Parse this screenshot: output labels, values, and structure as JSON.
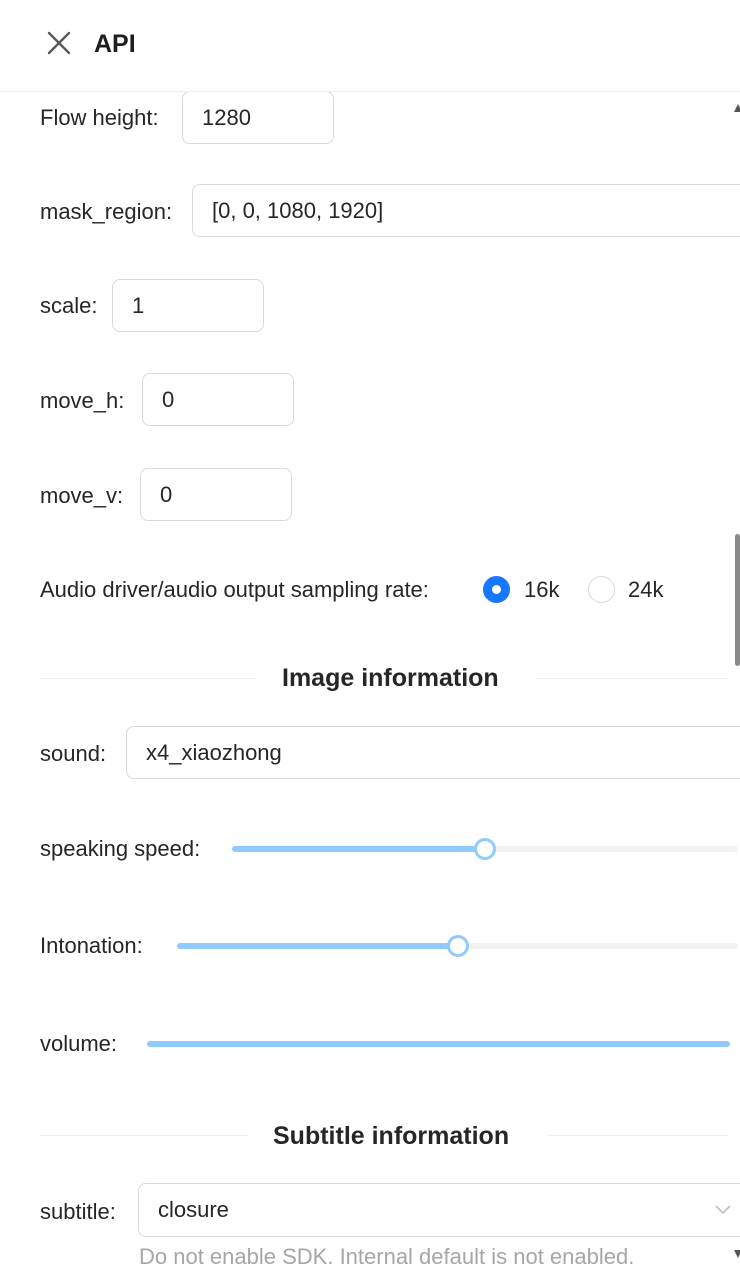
{
  "header": {
    "title": "API"
  },
  "form": {
    "flow_height": {
      "label": "Flow height:",
      "value": "1280"
    },
    "mask_region": {
      "label": "mask_region:",
      "value": "[0, 0, 1080, 1920]"
    },
    "scale": {
      "label": "scale:",
      "value": "1"
    },
    "move_h": {
      "label": "move_h:",
      "value": "0"
    },
    "move_v": {
      "label": "move_v:",
      "value": "0"
    },
    "sampling_rate": {
      "label": "Audio driver/audio output sampling rate:",
      "options": [
        "16k",
        "24k"
      ],
      "selected": "16k"
    }
  },
  "image_info": {
    "heading": "Image information",
    "sound": {
      "label": "sound:",
      "value": "x4_xiaozhong"
    },
    "speaking_speed": {
      "label": "speaking speed:",
      "level_percent": 50
    },
    "intonation": {
      "label": "Intonation:",
      "level_percent": 50
    },
    "volume": {
      "label": "volume:",
      "level_percent": 100
    }
  },
  "subtitle_info": {
    "heading": "Subtitle information",
    "subtitle": {
      "label": "subtitle:",
      "value": "closure",
      "help": "Do not enable SDK. Internal default is not enabled."
    }
  },
  "colors": {
    "primary": "#1677ff",
    "slider_track": "#91caff",
    "border": "#d9d9d9"
  },
  "icons": {
    "close": "close-icon",
    "dropdown": "chevron-down-icon"
  }
}
